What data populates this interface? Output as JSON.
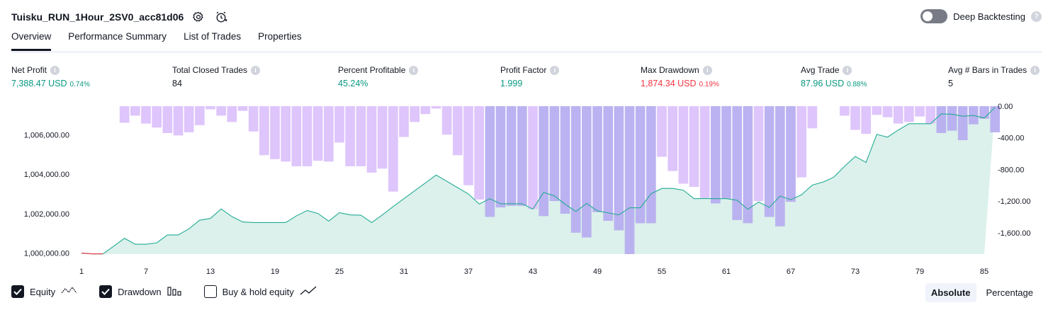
{
  "header": {
    "title": "Tuisku_RUN_1Hour_2SV0_acc81d06",
    "deep_label": "Deep Backtesting",
    "help_glyph": "?"
  },
  "tabs": [
    {
      "label": "Overview"
    },
    {
      "label": "Performance Summary"
    },
    {
      "label": "List of Trades"
    },
    {
      "label": "Properties"
    }
  ],
  "metrics": [
    {
      "label": "Net Profit",
      "value": "7,388.47 USD",
      "pct": "0.74%",
      "tone": "green"
    },
    {
      "label": "Total Closed Trades",
      "value": "84",
      "pct": "",
      "tone": "neutral"
    },
    {
      "label": "Percent Profitable",
      "value": "45.24%",
      "pct": "",
      "tone": "green"
    },
    {
      "label": "Profit Factor",
      "value": "1.999",
      "pct": "",
      "tone": "green"
    },
    {
      "label": "Max Drawdown",
      "value": "1,874.34 USD",
      "pct": "0.19%",
      "tone": "red"
    },
    {
      "label": "Avg Trade",
      "value": "87.96 USD",
      "pct": "0.88%",
      "tone": "green"
    },
    {
      "label": "Avg # Bars in Trades",
      "value": "5",
      "pct": "",
      "tone": "neutral"
    }
  ],
  "legend": {
    "equity": "Equity",
    "drawdown": "Drawdown",
    "buyhold": "Buy & hold equity"
  },
  "mode": {
    "absolute": "Absolute",
    "percentage": "Percentage"
  },
  "colors": {
    "equity_line": "#22ab94",
    "equity_fill": "#d6efe8",
    "equity_negative": "#f23645",
    "drawdown_bar": "#dcc2fb",
    "drawdown_overlap": "#b7aef0"
  },
  "chart_data": {
    "type": "area",
    "x": [
      1,
      2,
      3,
      4,
      5,
      6,
      7,
      8,
      9,
      10,
      11,
      12,
      13,
      14,
      15,
      16,
      17,
      18,
      19,
      20,
      21,
      22,
      23,
      24,
      25,
      26,
      27,
      28,
      29,
      30,
      31,
      32,
      33,
      34,
      35,
      36,
      37,
      38,
      39,
      40,
      41,
      42,
      43,
      44,
      45,
      46,
      47,
      48,
      49,
      50,
      51,
      52,
      53,
      54,
      55,
      56,
      57,
      58,
      59,
      60,
      61,
      62,
      63,
      64,
      65,
      66,
      67,
      68,
      69,
      70,
      71,
      72,
      73,
      74,
      75,
      76,
      77,
      78,
      79,
      80,
      81,
      82,
      83,
      84,
      85
    ],
    "x_ticks": [
      1,
      7,
      13,
      19,
      25,
      31,
      37,
      43,
      49,
      55,
      61,
      67,
      73,
      79,
      85
    ],
    "series": [
      {
        "name": "Equity",
        "axis": "left",
        "values": [
          1000000,
          999960,
          999960,
          1000350,
          1000750,
          1000450,
          1000450,
          1000520,
          1000920,
          1000920,
          1001230,
          1001670,
          1001760,
          1002240,
          1001850,
          1001580,
          1001550,
          1001550,
          1001550,
          1001550,
          1001890,
          1002160,
          1002010,
          1001620,
          1002050,
          1001940,
          1001920,
          1001550,
          1001940,
          1002360,
          1002760,
          1003160,
          1003560,
          1003960,
          1003640,
          1003320,
          1003000,
          1002490,
          1002760,
          1002500,
          1002500,
          1002500,
          1002230,
          1003080,
          1002900,
          1002480,
          1002110,
          1002520,
          1002140,
          1002040,
          1001940,
          1002300,
          1002300,
          1003010,
          1003280,
          1003280,
          1003190,
          1002760,
          1002770,
          1002760,
          1002760,
          1002680,
          1002220,
          1002590,
          1002320,
          1002890,
          1002710,
          1002960,
          1003450,
          1003600,
          1003850,
          1004400,
          1004900,
          1004600,
          1006020,
          1005880,
          1006240,
          1006560,
          1006560,
          1006560,
          1007060,
          1007040,
          1006940,
          1006980,
          1006850,
          1007390
        ]
      },
      {
        "name": "Drawdown",
        "axis": "right",
        "values": [
          0,
          0,
          0,
          0,
          -210,
          -120,
          -220,
          -270,
          -340,
          -370,
          -330,
          -240,
          -40,
          -120,
          -200,
          -60,
          -320,
          -620,
          -670,
          -700,
          -760,
          -760,
          -690,
          -700,
          -460,
          -760,
          -760,
          -840,
          -790,
          -1080,
          -390,
          -200,
          -100,
          -30,
          -360,
          -620,
          -1000,
          -1180,
          -1400,
          -1280,
          -1260,
          -1260,
          -1300,
          -1390,
          -1200,
          -1360,
          -1600,
          -1660,
          -1340,
          -1450,
          -1570,
          -1870,
          -1480,
          -1480,
          -640,
          -820,
          -980,
          -1020,
          -1160,
          -1230,
          -1170,
          -1440,
          -1480,
          -1200,
          -1400,
          -1520,
          -1210,
          -900,
          -280,
          0,
          0,
          -120,
          -300,
          -350,
          -110,
          -140,
          -220,
          -200,
          -130,
          -220,
          -340,
          -310,
          -430,
          -230,
          -160,
          -330
        ]
      }
    ],
    "ylim_left": [
      999950,
      1007450
    ],
    "yticks_left": [
      1000000,
      1002000,
      1004000,
      1006000
    ],
    "ylim_right": [
      -1870,
      0
    ],
    "yticks_right": [
      0,
      -400,
      -800,
      -1200,
      -1600
    ],
    "grid": false
  }
}
